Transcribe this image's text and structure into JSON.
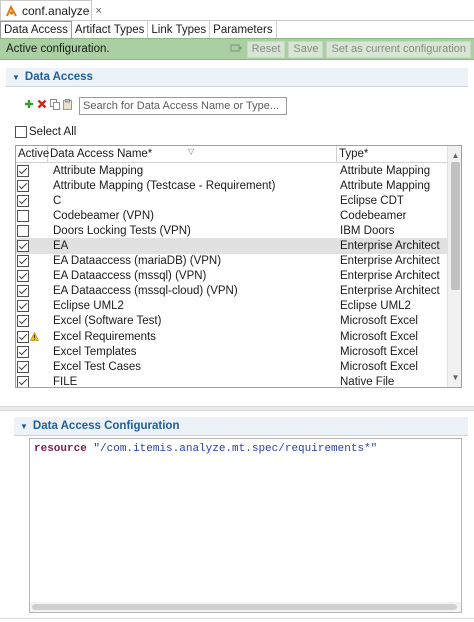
{
  "window": {
    "title": "conf.analyze",
    "close_glyph": "×"
  },
  "tabs": [
    {
      "label": "Data Access",
      "active": true
    },
    {
      "label": "Artifact Types",
      "active": false
    },
    {
      "label": "Link Types",
      "active": false
    },
    {
      "label": "Parameters",
      "active": false
    }
  ],
  "status": {
    "message": "Active configuration.",
    "reset_label": "Reset",
    "save_label": "Save",
    "set_current_label": "Set as current configuration",
    "background_color": "#a9cfa2"
  },
  "data_access": {
    "section_title": "Data Access",
    "search_placeholder": "Search for Data Access Name or Type...",
    "select_all_label": "Select All",
    "columns": {
      "active": "Active",
      "name": "Data Access Name*",
      "type": "Type*"
    },
    "rows": [
      {
        "active": true,
        "name": "Attribute Mapping",
        "type": "Attribute Mapping"
      },
      {
        "active": true,
        "name": "Attribute Mapping (Testcase - Requirement)",
        "type": "Attribute Mapping"
      },
      {
        "active": true,
        "name": "C",
        "type": "Eclipse CDT"
      },
      {
        "active": false,
        "name": "Codebeamer (VPN)",
        "type": "Codebeamer"
      },
      {
        "active": false,
        "name": "Doors Locking Tests (VPN)",
        "type": "IBM Doors"
      },
      {
        "active": true,
        "name": "EA",
        "type": "Enterprise Architect",
        "selected": true
      },
      {
        "active": true,
        "name": "EA Dataaccess (mariaDB) (VPN)",
        "type": "Enterprise Architect"
      },
      {
        "active": true,
        "name": "EA Dataaccess (mssql) (VPN)",
        "type": "Enterprise Architect"
      },
      {
        "active": true,
        "name": "EA Dataaccess (mssql-cloud) (VPN)",
        "type": "Enterprise Architect"
      },
      {
        "active": true,
        "name": "Eclipse UML2",
        "type": "Eclipse UML2"
      },
      {
        "active": true,
        "name": "Excel (Software Test)",
        "type": "Microsoft Excel"
      },
      {
        "active": true,
        "name": "Excel Requirements",
        "type": "Microsoft Excel",
        "warning": true
      },
      {
        "active": true,
        "name": "Excel Templates",
        "type": "Microsoft Excel"
      },
      {
        "active": true,
        "name": "Excel Test Cases",
        "type": "Microsoft Excel"
      },
      {
        "active": true,
        "name": "FILE",
        "type": "Native File"
      }
    ]
  },
  "configuration": {
    "section_title": "Data Access Configuration",
    "keyword": "resource",
    "value": "\"/com.itemis.analyze.mt.spec/requirements*\""
  },
  "icons": {
    "file": "analyze-file-icon",
    "add": "add-icon",
    "delete": "delete-icon",
    "copy": "copy-icon",
    "paste": "paste-icon",
    "pin": "pin-icon",
    "warning": "warning-icon",
    "accent_color": "#1e5f99"
  }
}
